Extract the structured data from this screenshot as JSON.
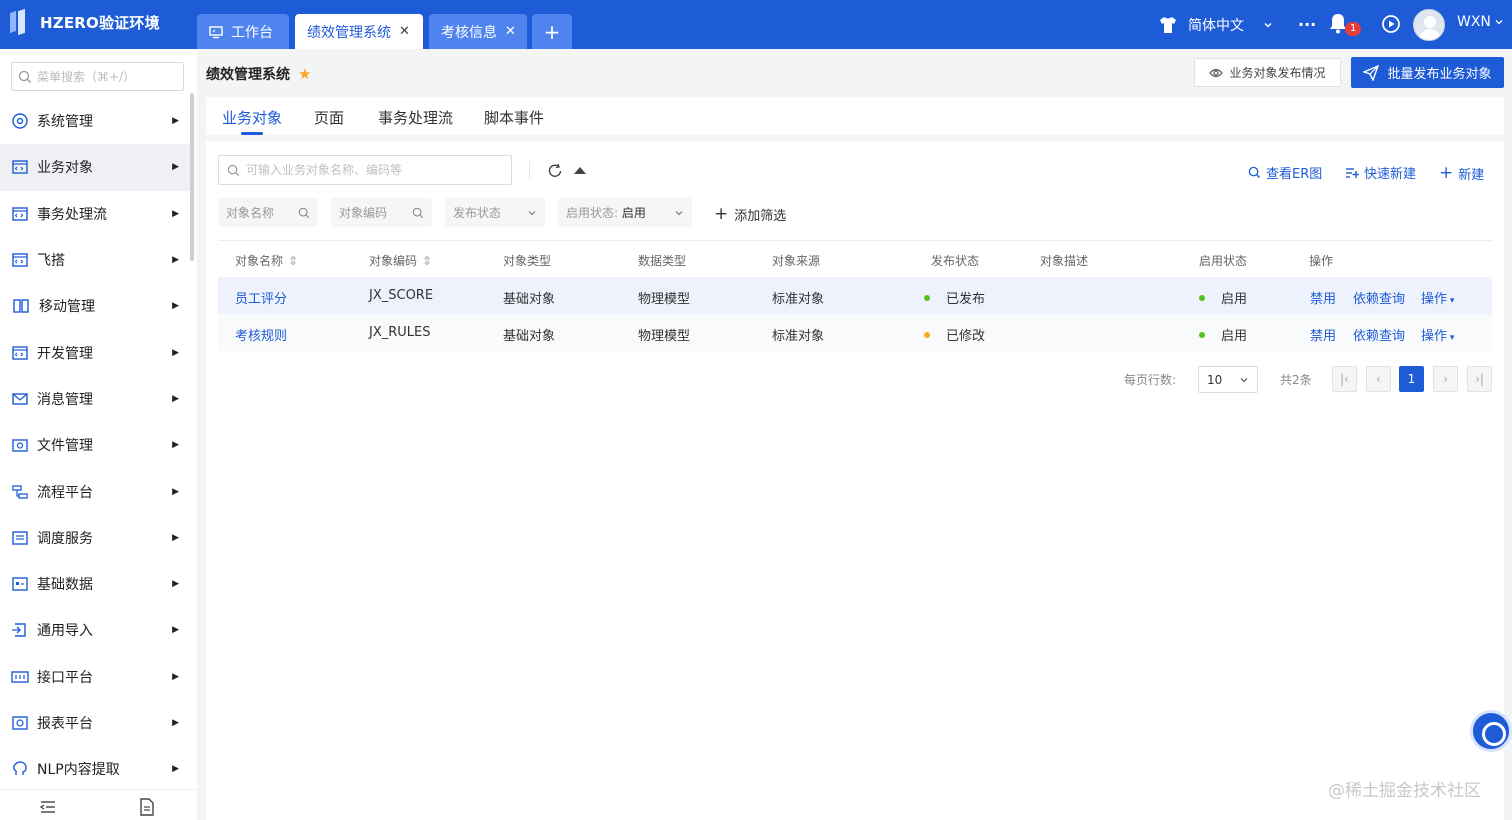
{
  "app": {
    "title": "HZERO验证环境"
  },
  "tabs": [
    {
      "label": "工作台"
    },
    {
      "label": "绩效管理系统"
    },
    {
      "label": "考核信息"
    }
  ],
  "header_right": {
    "language": "简体中文",
    "more": "···",
    "notification_count": "1",
    "user": "WXN"
  },
  "sidebar": {
    "search_placeholder": "菜单搜索（⌘+/）",
    "items": [
      {
        "label": "系统管理"
      },
      {
        "label": "业务对象"
      },
      {
        "label": "事务处理流"
      },
      {
        "label": "飞搭"
      },
      {
        "label": "移动管理"
      },
      {
        "label": "开发管理"
      },
      {
        "label": "消息管理"
      },
      {
        "label": "文件管理"
      },
      {
        "label": "流程平台"
      },
      {
        "label": "调度服务"
      },
      {
        "label": "基础数据"
      },
      {
        "label": "通用导入"
      },
      {
        "label": "接口平台"
      },
      {
        "label": "报表平台"
      },
      {
        "label": "NLP内容提取"
      }
    ]
  },
  "page": {
    "title": "绩效管理系统",
    "publish_status_button": "业务对象发布情况",
    "batch_publish_button": "批量发布业务对象"
  },
  "subtabs": [
    {
      "label": "业务对象"
    },
    {
      "label": "页面"
    },
    {
      "label": "事务处理流"
    },
    {
      "label": "脚本事件"
    }
  ],
  "toolbar": {
    "search_placeholder": "可输入业务对象名称、编码等",
    "er_link": "查看ER图",
    "quick_new": "快速新建",
    "new": "新建"
  },
  "filters": {
    "name": "对象名称",
    "code": "对象编码",
    "publish": "发布状态",
    "enable_label": "启用状态:",
    "enable_value": "启用",
    "add": "添加筛选"
  },
  "table": {
    "headers": [
      "对象名称",
      "对象编码",
      "对象类型",
      "数据类型",
      "对象来源",
      "发布状态",
      "对象描述",
      "启用状态",
      "操作"
    ],
    "rows": [
      {
        "name": "员工评分",
        "code": "JX_SCORE",
        "type": "基础对象",
        "data_type": "物理模型",
        "source": "标准对象",
        "publish": "已发布",
        "publish_color": "#52c41a",
        "desc": "",
        "enable": "启用",
        "enable_color": "#52c41a",
        "act_disable": "禁用",
        "act_dep": "依赖查询",
        "act_more": "操作"
      },
      {
        "name": "考核规则",
        "code": "JX_RULES",
        "type": "基础对象",
        "data_type": "物理模型",
        "source": "标准对象",
        "publish": "已修改",
        "publish_color": "#faad14",
        "desc": "",
        "enable": "启用",
        "enable_color": "#52c41a",
        "act_disable": "禁用",
        "act_dep": "依赖查询",
        "act_more": "操作"
      }
    ]
  },
  "pagination": {
    "rows_label": "每页行数:",
    "page_size": "10",
    "total": "共2条",
    "current": "1"
  },
  "watermark": "@稀土掘金技术社区",
  "colors": {
    "brand": "#1e5bd7",
    "published": "#52c41a",
    "modified": "#faad14"
  }
}
